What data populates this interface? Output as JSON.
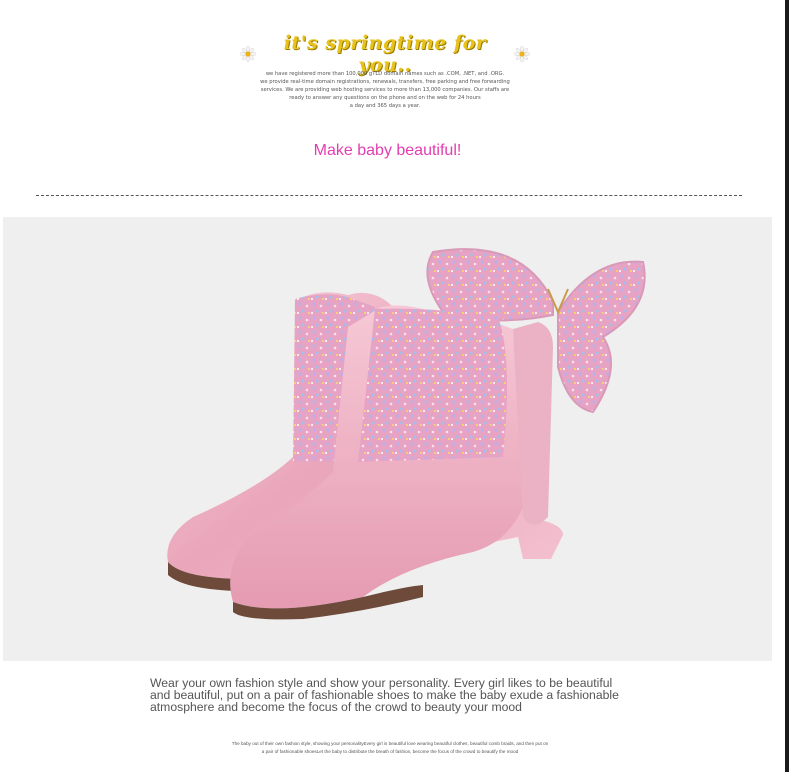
{
  "banner": {
    "title": "it's springtime for you..",
    "lines": [
      "we have registered more than 100,000 gTLD domain names such as .COM, .NET, and .ORG.",
      "we provide real-time domain registrations, renewals, transfers, free parking and free forwarding",
      "services. We are providing web hosting services to more than 13,000 companies. Our staffs are",
      "ready to answer any questions on the phone and on the web for 24 hours",
      "a day and 365 days a year."
    ],
    "icons": [
      "daisy-icon",
      "daisy-icon"
    ]
  },
  "tagline": "Make baby beautiful!",
  "product_image": {
    "subject": "pink glitter ankle boots with butterfly",
    "colors": {
      "background": "#efefef",
      "leather": "#f2b7c6",
      "glitter": "#e8a2c6",
      "butterfly": "#e795c0"
    }
  },
  "description": "Wear your own fashion style and show your personality. Every girl likes to be beautiful and beautiful, put on a pair of fashionable shoes to make the baby exude a fashionable atmosphere and become the focus of the crowd to beauty your mood",
  "fine_print": [
    "The baby out of their own fashion style, showing your personalityEvery girl is beautiful love wearing beautiful clothes, beautiful comb braids, and then put on",
    "a pair of fashionable shoesLet the baby to distribute the breath of fashion, become the focus of the crowd to beautify the mood"
  ]
}
